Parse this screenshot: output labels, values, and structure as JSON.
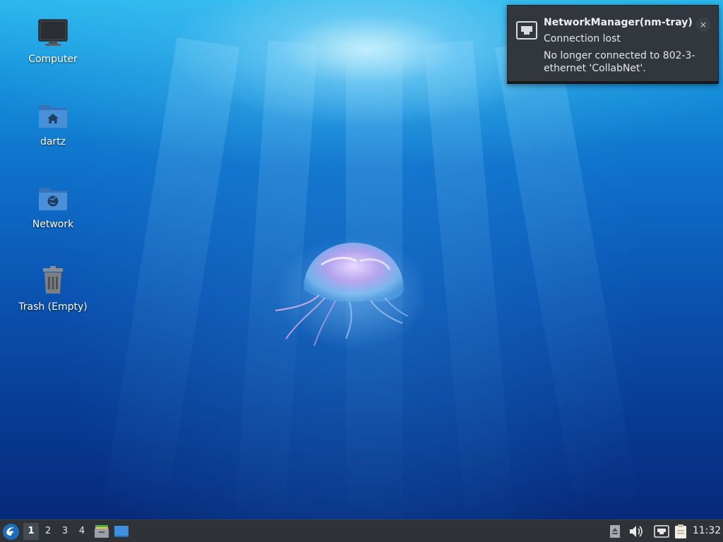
{
  "desktop": {
    "icons": [
      {
        "label": "Computer",
        "icon": "computer-icon"
      },
      {
        "label": "dartz",
        "icon": "home-folder-icon"
      },
      {
        "label": "Network",
        "icon": "network-folder-icon"
      },
      {
        "label": "Trash (Empty)",
        "icon": "trash-icon"
      }
    ]
  },
  "notification": {
    "app": "NetworkManager(nm-tray)",
    "summary": "Connection lost",
    "body": "No longer connected to 802-3-ethernet 'CollabNet'.",
    "icon": "ethernet-icon",
    "close_label": "×"
  },
  "taskbar": {
    "start_icon": "lxqt-menu-icon",
    "workspaces": [
      "1",
      "2",
      "3",
      "4"
    ],
    "active_workspace": "1",
    "launchers": [
      "file-manager-icon",
      "desktop-icon"
    ],
    "tray": [
      "removable-media-icon",
      "volume-icon",
      "network-icon",
      "clipboard-icon"
    ],
    "clock": "11:32"
  },
  "colors": {
    "panel": "#2f3338",
    "notification_bg": "#32373d",
    "folder_blue": "#4a90d9",
    "sea_top": "#29b7ec",
    "sea_bottom": "#06297a"
  }
}
